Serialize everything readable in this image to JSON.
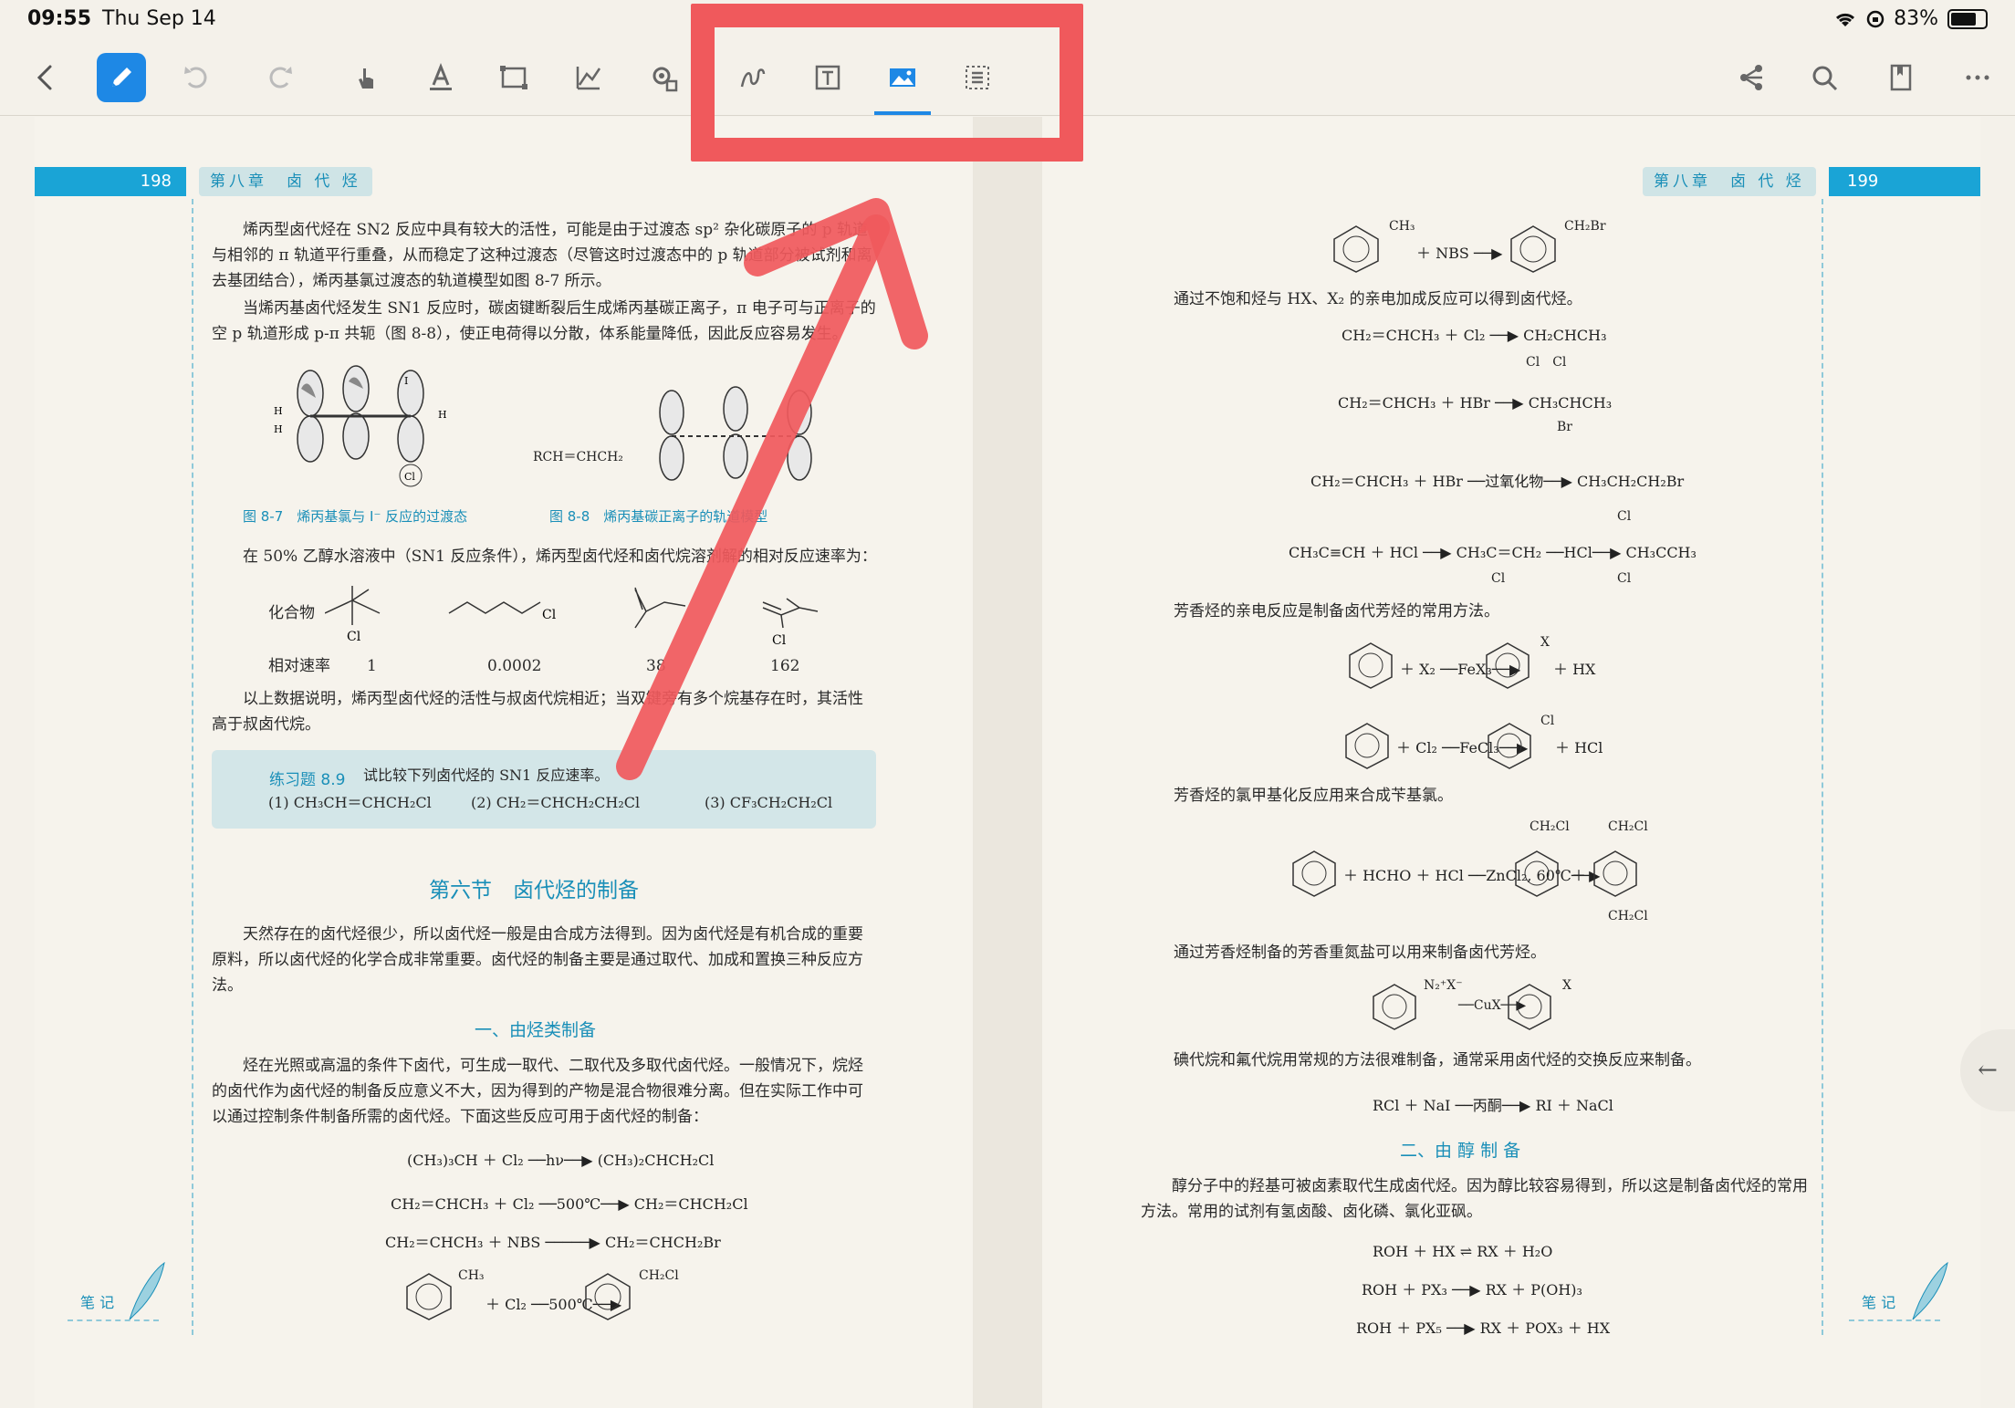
{
  "status": {
    "time": "09:55",
    "date": "Thu Sep 14",
    "battery": "83%",
    "battery_level": 0.83
  },
  "toolbar": {
    "items": [
      "back",
      "pen",
      "undo",
      "redo",
      "hand",
      "text-highlight",
      "rect-select",
      "chart",
      "settings",
      "lasso",
      "textbox",
      "image",
      "grid-select"
    ],
    "right_items": [
      "share",
      "search",
      "bookmark",
      "more"
    ]
  },
  "left_page": {
    "page_number": "198",
    "chapter": "第八章　卤 代 烃",
    "p1": "烯丙型卤代烃在 SN2 反应中具有较大的活性，可能是由于过渡态 sp² 杂化碳原子的 p 轨道与相邻的 π 轨道平行重叠，从而稳定了这种过渡态（尽管这时过渡态中的 p 轨道部分被试剂和离去基团结合），烯丙基氯过渡态的轨道模型如图 8-7 所示。",
    "p2": "当烯丙基卤代烃发生 SN1 反应时，碳卤键断裂后生成烯丙基碳正离子，π 电子可与正离子的空 p 轨道形成 p-π 共轭（图 8-8），使正电荷得以分散，体系能量降低，因此反应容易发生。",
    "fig7_caption": "图 8-7　烯丙基氯与 I⁻ 反应的过渡态",
    "fig8_caption": "图 8-8　烯丙基碳正离子的轨道模型",
    "fig8_label": "RCH＝CHCH₂",
    "p3": "在 50% 乙醇水溶液中（SN1 反应条件），烯丙型卤代烃和卤代烷溶剂解的相对反应速率为：",
    "rates_label": "化合物",
    "rates_row_label": "相对速率",
    "rates": [
      "1",
      "0.0002",
      "38",
      "162"
    ],
    "p4": "以上数据说明，烯丙型卤代烃的活性与叔卤代烷相近；当双键旁有多个烷基存在时，其活性高于叔卤代烷。",
    "exercise_title": "练习题 8.9",
    "exercise_text": "试比较下列卤代烃的 SN1 反应速率。",
    "exercise_items": [
      "(1) CH₃CH＝CHCH₂Cl",
      "(2) CH₂＝CHCH₂CH₂Cl",
      "(3) CF₃CH₂CH₂Cl"
    ],
    "section_title": "第六节　卤代烃的制备",
    "p5": "天然存在的卤代烃很少，所以卤代烃一般是由合成方法得到。因为卤代烃是有机合成的重要原料，所以卤代烃的化学合成非常重要。卤代烃的制备主要是通过取代、加成和置换三种反应方法。",
    "sub1": "一、由烃类制备",
    "p6": "烃在光照或高温的条件下卤代，可生成一取代、二取代及多取代卤代烃。一般情况下，烷烃的卤代作为卤代烃的制备反应意义不大，因为得到的产物是混合物很难分离。但在实际工作中可以通过控制条件制备所需的卤代烃。下面这些反应可用于卤代烃的制备：",
    "eqs": [
      "(CH₃)₃CH ＋ Cl₂ ──hν──▶ (CH₃)₂CHCH₂Cl",
      "CH₂＝CHCH₃ ＋ Cl₂ ──500℃──▶ CH₂＝CHCH₂Cl",
      "CH₂＝CHCH₃ ＋ NBS ─────▶ CH₂＝CHCH₂Br"
    ],
    "eq_toluene": "＋ Cl₂ ──500℃──▶",
    "eq_toluene_sub1": "CH₃",
    "eq_toluene_sub2": "CH₂Cl",
    "notes": "笔 记"
  },
  "right_page": {
    "page_number": "199",
    "chapter": "第八章　卤 代 烃",
    "eq_nbs": "＋ NBS ──▶",
    "eq_nbs_sub1": "CH₃",
    "eq_nbs_sub2": "CH₂Br",
    "p1": "通过不饱和烃与 HX、X₂ 的亲电加成反应可以得到卤代烃。",
    "eqs": [
      "CH₂＝CHCH₃ ＋ Cl₂ ──▶ CH₂CHCH₃",
      "CH₂＝CHCH₃ ＋ HBr ──▶ CH₃CHCH₃",
      "CH₂＝CHCH₃ ＋ HBr ──过氧化物──▶ CH₃CH₂CH₂Br",
      "CH₃C≡CH ＋ HCl ──▶ CH₃C＝CH₂ ──HCl──▶ CH₃CCH₃"
    ],
    "eq_subs": [
      "Cl　Cl",
      "Br",
      "Cl",
      "Cl",
      "Cl"
    ],
    "p2": "芳香烃的亲电反应是制备卤代芳烃的常用方法。",
    "eq_ar1": "＋ X₂ ──FeX₃──▶",
    "eq_ar1_tail": "＋ HX",
    "eq_ar1_sub": "X",
    "eq_ar2": "＋ Cl₂ ──FeCl₃──▶",
    "eq_ar2_tail": "＋ HCl",
    "eq_ar2_sub": "Cl",
    "p3": "芳香烃的氯甲基化反应用来合成苄基氯。",
    "eq_ar3": "＋ HCHO ＋ HCl ──ZnCl₂, 60℃──▶",
    "eq_ar3_plus": "＋",
    "eq_ar3_subs": [
      "CH₂Cl",
      "CH₂Cl",
      "CH₂Cl"
    ],
    "p4": "通过芳香烃制备的芳香重氮盐可以用来制备卤代芳烃。",
    "eq_diazo": "──CuX──▶",
    "eq_diazo_subs": [
      "N₂⁺X⁻",
      "X"
    ],
    "p5": "碘代烷和氟代烷用常规的方法很难制备，通常采用卤代烃的交换反应来制备。",
    "eq_exchange": "RCl ＋ NaI ──丙酮──▶ RI ＋ NaCl",
    "sub2": "二、由 醇 制 备",
    "p6": "醇分子中的羟基可被卤素取代生成卤代烃。因为醇比较容易得到，所以这是制备卤代烃的常用方法。常用的试剂有氢卤酸、卤化磷、氯化亚砜。",
    "eqs2": [
      "ROH ＋ HX ⇌ RX ＋ H₂O",
      "ROH ＋ PX₃ ──▶ RX ＋ P(OH)₃",
      "ROH ＋ PX₅ ──▶ RX ＋ POX₃ ＋ HX"
    ],
    "notes": "笔 记"
  }
}
